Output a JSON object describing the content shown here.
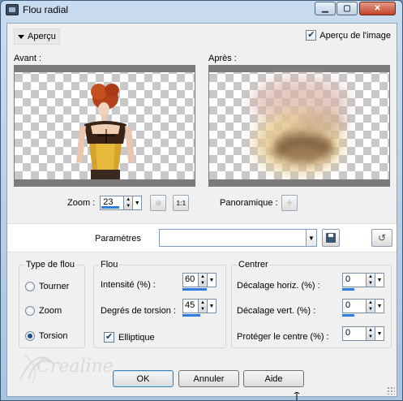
{
  "window": {
    "title": "Flou radial",
    "controls": [
      "minimize",
      "maximize",
      "close"
    ]
  },
  "preview_section": {
    "toggle_label": "Aperçu",
    "preview_on_image_label": "Aperçu de l'image",
    "preview_on_image_checked": true,
    "before_label": "Avant :",
    "after_label": "Après :"
  },
  "zoom": {
    "label": "Zoom :",
    "value": "23",
    "pan_label": "Panoramique :"
  },
  "parameters": {
    "label": "Paramètres",
    "value": ""
  },
  "blur_type": {
    "title": "Type de flou",
    "options": [
      {
        "label": "Tourner",
        "selected": false
      },
      {
        "label": "Zoom",
        "selected": false
      },
      {
        "label": "Torsion",
        "selected": true
      }
    ]
  },
  "blur": {
    "title": "Flou",
    "intensity_label": "Intensité (%) :",
    "intensity_value": "60",
    "twist_label": "Degrés de torsion :",
    "twist_value": "45",
    "elliptical_label": "Elliptique",
    "elliptical_checked": true
  },
  "center": {
    "title": "Centrer",
    "horiz_label": "Décalage horiz. (%) :",
    "horiz_value": "0",
    "vert_label": "Décalage vert. (%) :",
    "vert_value": "0",
    "protect_label": "Protéger le centre (%) :",
    "protect_value": "0"
  },
  "buttons": {
    "ok": "OK",
    "cancel": "Annuler",
    "help": "Aide"
  },
  "watermark": "Crealine",
  "colors": {
    "accent": "#2f7be0",
    "close_button": "#c1442a"
  }
}
